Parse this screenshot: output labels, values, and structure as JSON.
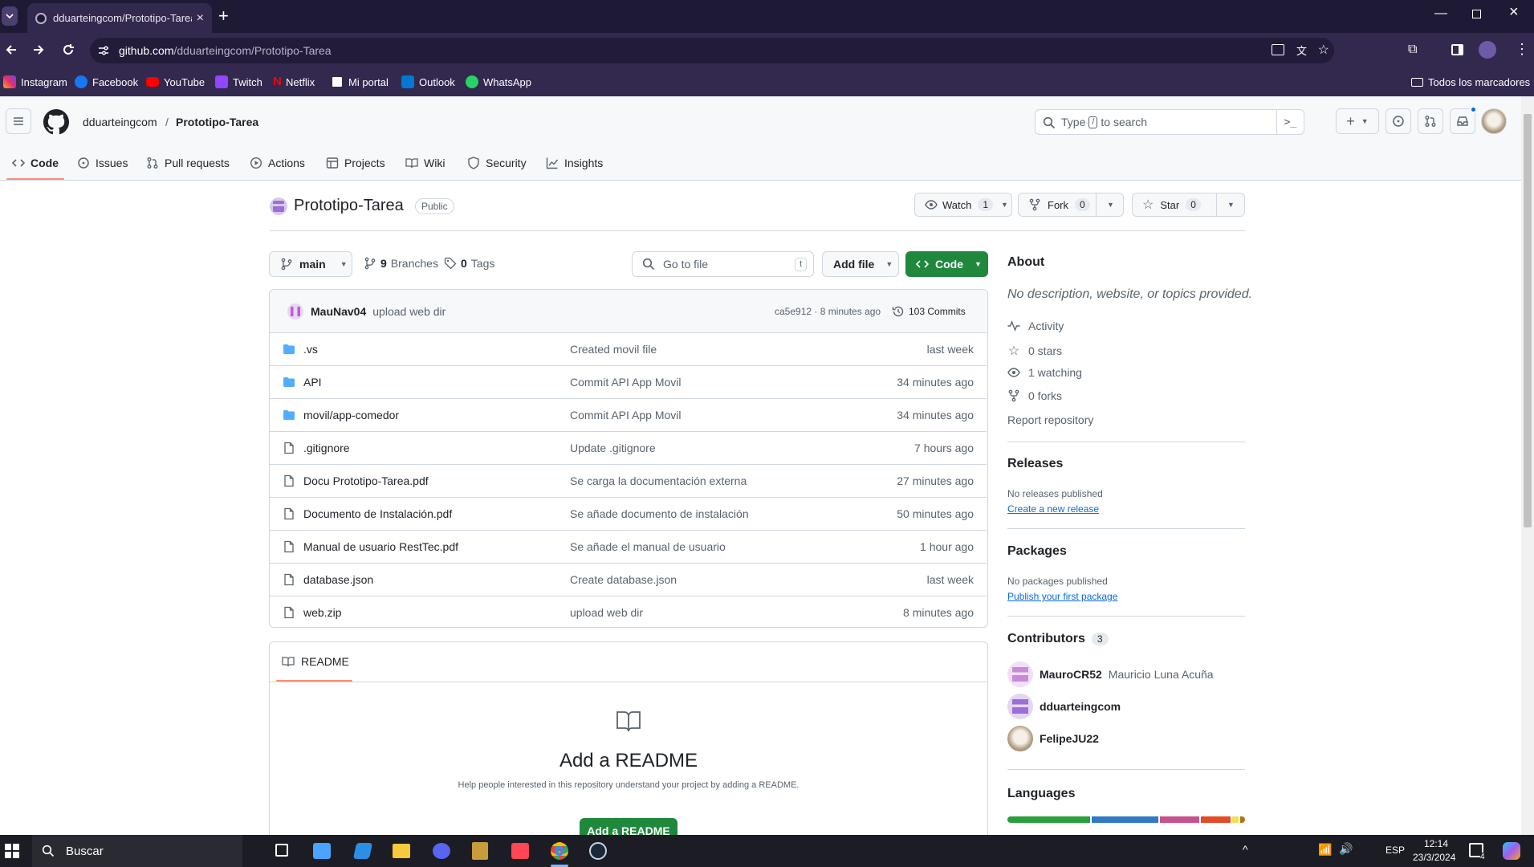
{
  "browser": {
    "tab_title": "dduarteingcom/Prototipo-Tarea",
    "url_host": "github.com",
    "url_path": "/dduarteingcom/Prototipo-Tarea",
    "bookmarks": [
      "Instagram",
      "Facebook",
      "YouTube",
      "Twitch",
      "Netflix",
      "Mi portal",
      "Outlook",
      "WhatsApp"
    ],
    "all_bookmarks": "Todos los marcadores"
  },
  "header": {
    "owner": "dduarteingcom",
    "separator": "/",
    "repo": "Prototipo-Tarea",
    "search_prefix": "Type",
    "search_key": "/",
    "search_suffix": "to search"
  },
  "nav_tabs": [
    "Code",
    "Issues",
    "Pull requests",
    "Actions",
    "Projects",
    "Wiki",
    "Security",
    "Insights"
  ],
  "repo": {
    "name": "Prototipo-Tarea",
    "visibility": "Public",
    "watch_label": "Watch",
    "watch_count": "1",
    "fork_label": "Fork",
    "fork_count": "0",
    "star_label": "Star",
    "star_count": "0"
  },
  "toolbar": {
    "branch": "main",
    "branches_count": "9",
    "branches_label": "Branches",
    "tags_count": "0",
    "tags_label": "Tags",
    "goto_placeholder": "Go to file",
    "goto_key": "t",
    "add_file": "Add file",
    "code": "Code"
  },
  "commit": {
    "author": "MauNav04",
    "message": "upload web dir",
    "meta": "ca5e912 · 8 minutes ago",
    "count": "103 Commits"
  },
  "files": [
    {
      "name": ".vs",
      "type": "folder",
      "message": "Created movil file",
      "time": "last week"
    },
    {
      "name": "API",
      "type": "folder",
      "message": "Commit API App Movil",
      "time": "34 minutes ago"
    },
    {
      "name": "movil/app-comedor",
      "type": "folder",
      "message": "Commit API App Movil",
      "time": "34 minutes ago"
    },
    {
      "name": ".gitignore",
      "type": "file",
      "message": "Update .gitignore",
      "time": "7 hours ago"
    },
    {
      "name": "Docu Prototipo-Tarea.pdf",
      "type": "file",
      "message": "Se carga la documentación externa",
      "time": "27 minutes ago"
    },
    {
      "name": "Documento de Instalación.pdf",
      "type": "file",
      "message": "Se añade documento de instalación",
      "time": "50 minutes ago"
    },
    {
      "name": "Manual de usuario RestTec.pdf",
      "type": "file",
      "message": "Se añade el manual de usuario",
      "time": "1 hour ago"
    },
    {
      "name": "database.json",
      "type": "file",
      "message": "Create database.json",
      "time": "last week"
    },
    {
      "name": "web.zip",
      "type": "file",
      "message": "upload web dir",
      "time": "8 minutes ago"
    }
  ],
  "readme": {
    "tab": "README",
    "title": "Add a README",
    "desc": "Help people interested in this repository understand your project by adding a README.",
    "button": "Add a README"
  },
  "about": {
    "title": "About",
    "desc": "No description, website, or topics provided.",
    "activity": "Activity",
    "stars": "0 stars",
    "watching": "1 watching",
    "forks": "0 forks",
    "report": "Report repository"
  },
  "releases": {
    "title": "Releases",
    "empty": "No releases published",
    "link": "Create a new release"
  },
  "packages": {
    "title": "Packages",
    "empty": "No packages published",
    "link": "Publish your first package"
  },
  "contributors": {
    "title": "Contributors",
    "count": "3",
    "list": [
      {
        "login": "MauroCR52",
        "name": "Mauricio Luna Acuña"
      },
      {
        "login": "dduarteingcom",
        "name": ""
      },
      {
        "login": "FelipeJU22",
        "name": ""
      }
    ]
  },
  "languages": {
    "title": "Languages",
    "bar": [
      {
        "color": "#2b9f3b",
        "share": 0.36
      },
      {
        "color": "#3178c6",
        "share": 0.29
      },
      {
        "color": "#c6538c",
        "share": 0.17
      },
      {
        "color": "#e34c26",
        "share": 0.13
      },
      {
        "color": "#f1e05a",
        "share": 0.03
      },
      {
        "color": "#b07219",
        "share": 0.02
      }
    ]
  },
  "taskbar": {
    "search": "Buscar",
    "lang": "ESP",
    "time": "12:14",
    "date": "23/3/2024",
    "notif": "4"
  },
  "colors": {
    "accent": "#fd8c73",
    "green": "#1f883d",
    "link": "#0969da",
    "folder": "#54aeff"
  }
}
